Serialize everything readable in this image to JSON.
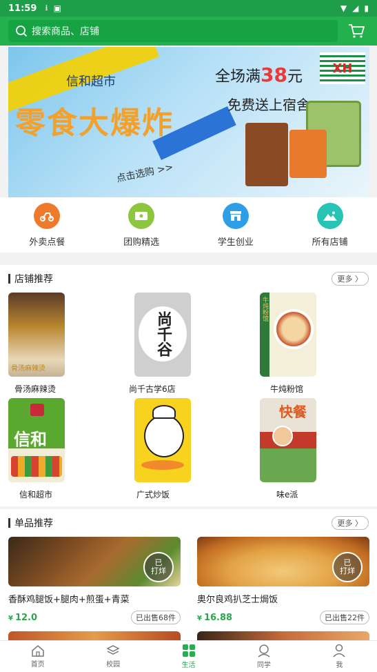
{
  "status_bar": {
    "time": "11:59"
  },
  "search": {
    "placeholder": "搜索商品、店铺"
  },
  "banner": {
    "brand": "信和超市",
    "headline": "零食大爆炸",
    "promo_line1_prefix": "全场满",
    "promo_amount": "38",
    "promo_line1_suffix": "元",
    "promo_line2": "免费送上宿舍",
    "cta": "点击选购 >>",
    "logo_text": "XH"
  },
  "quick_nav": [
    {
      "label": "外卖点餐",
      "icon": "scooter-icon",
      "color": "#f07a2c"
    },
    {
      "label": "团购精选",
      "icon": "ticket-icon",
      "color": "#8dc63f"
    },
    {
      "label": "学生创业",
      "icon": "store-icon",
      "color": "#2e9fe6"
    },
    {
      "label": "所有店铺",
      "icon": "mountain-image-icon",
      "color": "#27c3b5"
    }
  ],
  "shops_section": {
    "title": "店铺推荐",
    "more": "更多",
    "shops": [
      {
        "name": "骨汤麻辣烫",
        "img_text": "骨汤麻辣烫"
      },
      {
        "name": "尚千古学6店",
        "img_text": "尚千谷"
      },
      {
        "name": "牛炖粉馆",
        "img_text": "牛炖粉馆"
      },
      {
        "name": "信和超市",
        "img_text": "信和"
      },
      {
        "name": "广式炒饭",
        "img_text": ""
      },
      {
        "name": "味e派",
        "img_text": "快餐"
      }
    ]
  },
  "products_section": {
    "title": "单品推荐",
    "more": "更多",
    "products": [
      {
        "name": "香酥鸡腿饭+腿肉+煎蛋+青菜",
        "currency": "¥",
        "price": "12.0",
        "sold": "已出售68件",
        "badge_top": "已",
        "badge_bottom": "打烊"
      },
      {
        "name": "奥尔良鸡扒芝士焗饭",
        "currency": "¥",
        "price": "16.88",
        "sold": "已出售22件",
        "badge_top": "已",
        "badge_bottom": "打烊"
      }
    ]
  },
  "tab_bar": [
    {
      "label": "首页",
      "icon": "home-icon",
      "active": false
    },
    {
      "label": "校园",
      "icon": "layers-icon",
      "active": false
    },
    {
      "label": "生活",
      "icon": "grid-icon",
      "active": true
    },
    {
      "label": "同学",
      "icon": "classmates-icon",
      "active": false
    },
    {
      "label": "我",
      "icon": "person-icon",
      "active": false
    }
  ],
  "colors": {
    "brand_green": "#22b14c",
    "price_green": "#2aa64f"
  }
}
